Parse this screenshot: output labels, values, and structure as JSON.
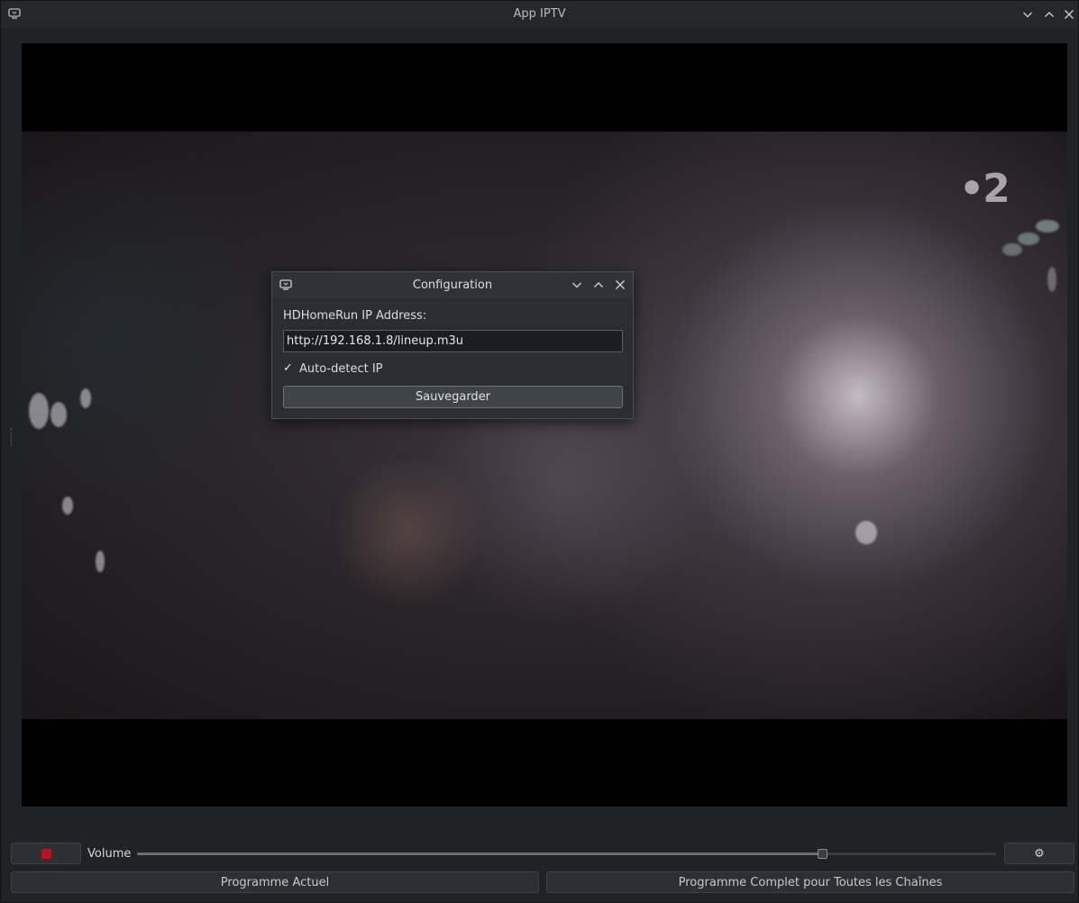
{
  "window": {
    "title": "App IPTV"
  },
  "video": {
    "channel_logo": "•2"
  },
  "dialog": {
    "title": "Configuration",
    "ip_label": "HDHomeRun IP Address:",
    "ip_value": "http://192.168.1.8/lineup.m3u",
    "auto_detect_checked": true,
    "auto_detect_mark": "✓",
    "auto_detect_label": "Auto-detect IP",
    "save_label": "Sauvegarder"
  },
  "controls": {
    "volume_label": "Volume",
    "volume_level": 0.797,
    "settings_glyph": "⚙",
    "current_program_label": "Programme Actuel",
    "full_program_label": "Programme Complet pour Toutes les Chaînes"
  },
  "colors": {
    "record_red": "#b3161c",
    "background": "#202326"
  }
}
